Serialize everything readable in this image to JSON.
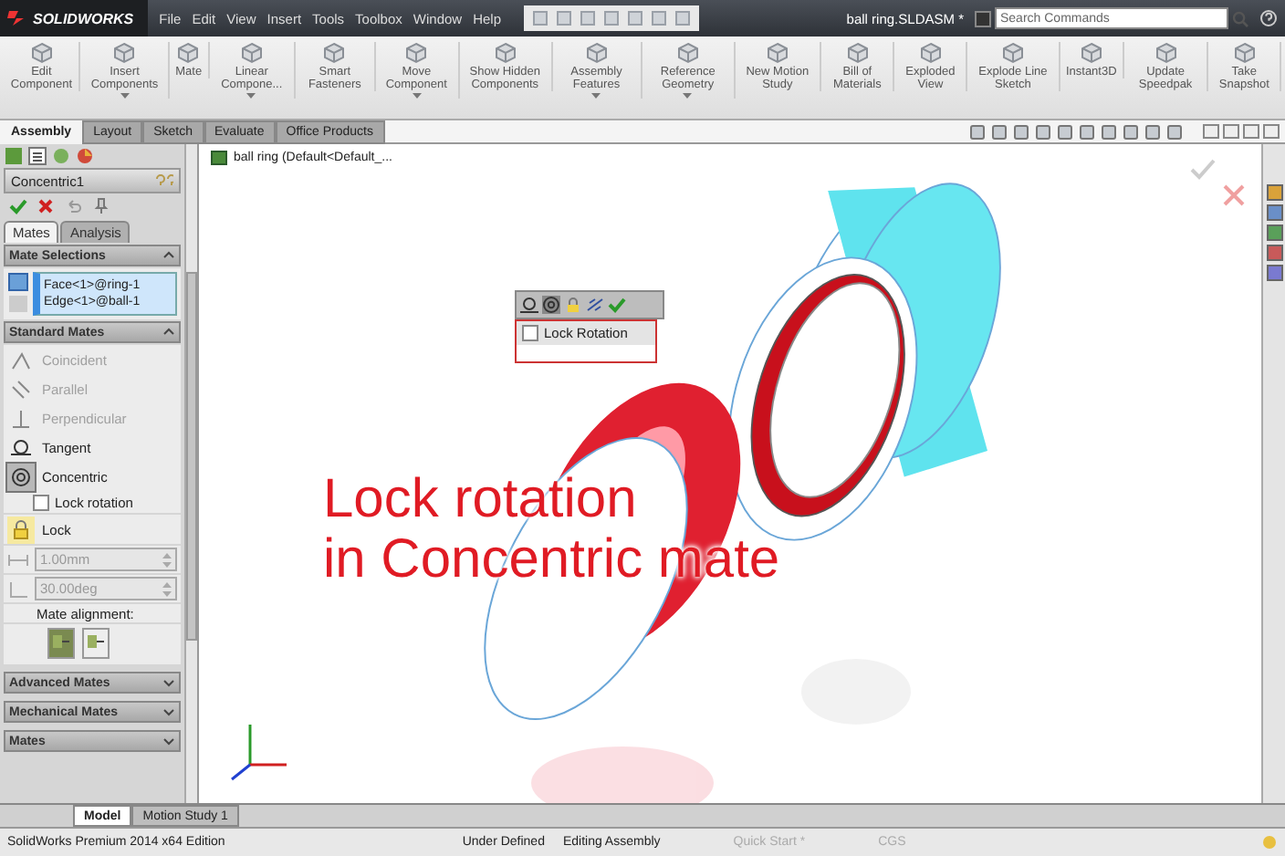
{
  "title_bar": {
    "logo": "SOLIDWORKS",
    "menus": [
      "File",
      "Edit",
      "View",
      "Insert",
      "Tools",
      "Toolbox",
      "Window",
      "Help"
    ],
    "document_title": "ball ring.SLDASM *",
    "search": {
      "placeholder": "Search Commands"
    }
  },
  "ribbon": [
    {
      "label": "Edit Component",
      "dropdown": false
    },
    {
      "label": "Insert Components",
      "dropdown": true
    },
    {
      "label": "Mate",
      "dropdown": false
    },
    {
      "label": "Linear Compone...",
      "dropdown": true
    },
    {
      "label": "Smart Fasteners",
      "dropdown": false
    },
    {
      "label": "Move Component",
      "dropdown": true
    },
    {
      "label": "Show Hidden Components",
      "dropdown": false
    },
    {
      "label": "Assembly Features",
      "dropdown": true
    },
    {
      "label": "Reference Geometry",
      "dropdown": true
    },
    {
      "label": "New Motion Study",
      "dropdown": false
    },
    {
      "label": "Bill of Materials",
      "dropdown": false
    },
    {
      "label": "Exploded View",
      "dropdown": false
    },
    {
      "label": "Explode Line Sketch",
      "dropdown": false
    },
    {
      "label": "Instant3D",
      "dropdown": false
    },
    {
      "label": "Update Speedpak",
      "dropdown": false
    },
    {
      "label": "Take Snapshot",
      "dropdown": false
    }
  ],
  "command_tabs": [
    {
      "label": "Assembly",
      "selected": true
    },
    {
      "label": "Layout",
      "selected": false
    },
    {
      "label": "Sketch",
      "selected": false
    },
    {
      "label": "Evaluate",
      "selected": false
    },
    {
      "label": "Office Products",
      "selected": false
    }
  ],
  "property_manager": {
    "title": "Concentric1",
    "tabs": [
      {
        "label": "Mates",
        "selected": true
      },
      {
        "label": "Analysis",
        "selected": false
      }
    ],
    "mate_selections": {
      "title": "Mate Selections",
      "items": [
        "Face<1>@ring-1",
        "Edge<1>@ball-1"
      ]
    },
    "standard_mates": {
      "title": "Standard Mates",
      "mates": [
        {
          "label": "Coincident",
          "kind": "coincident",
          "disabled": true,
          "selected": false
        },
        {
          "label": "Parallel",
          "kind": "parallel",
          "disabled": true,
          "selected": false
        },
        {
          "label": "Perpendicular",
          "kind": "perpendicular",
          "disabled": true,
          "selected": false
        },
        {
          "label": "Tangent",
          "kind": "tangent",
          "disabled": false,
          "selected": false
        },
        {
          "label": "Concentric",
          "kind": "concentric",
          "disabled": false,
          "selected": true
        }
      ],
      "lock_rotation": {
        "label": "Lock rotation",
        "checked": false
      },
      "lock_label": "Lock",
      "distance": {
        "value": "1.00mm",
        "disabled": true
      },
      "angle": {
        "value": "30.00deg",
        "disabled": true
      },
      "alignment_label": "Mate alignment:",
      "alignment": [
        {
          "selected": true
        },
        {
          "selected": false
        }
      ]
    },
    "collapsed_sections": [
      {
        "title": "Advanced Mates"
      },
      {
        "title": "Mechanical Mates"
      },
      {
        "title": "Mates"
      }
    ]
  },
  "graphics": {
    "tree_label": "ball ring (Default<Default_...",
    "popup": {
      "lock_rotation": {
        "label": "Lock Rotation",
        "checked": false
      }
    },
    "annotation": [
      "Lock rotation",
      "in Concentric mate"
    ]
  },
  "bottom_tabs": [
    {
      "label": "Model",
      "selected": true
    },
    {
      "label": "Motion Study 1",
      "selected": false
    }
  ],
  "status_bar": {
    "edition": "SolidWorks Premium 2014 x64 Edition",
    "state": "Under Defined",
    "mode": "Editing Assembly",
    "quick_start": "Quick Start *",
    "units": "CGS"
  }
}
